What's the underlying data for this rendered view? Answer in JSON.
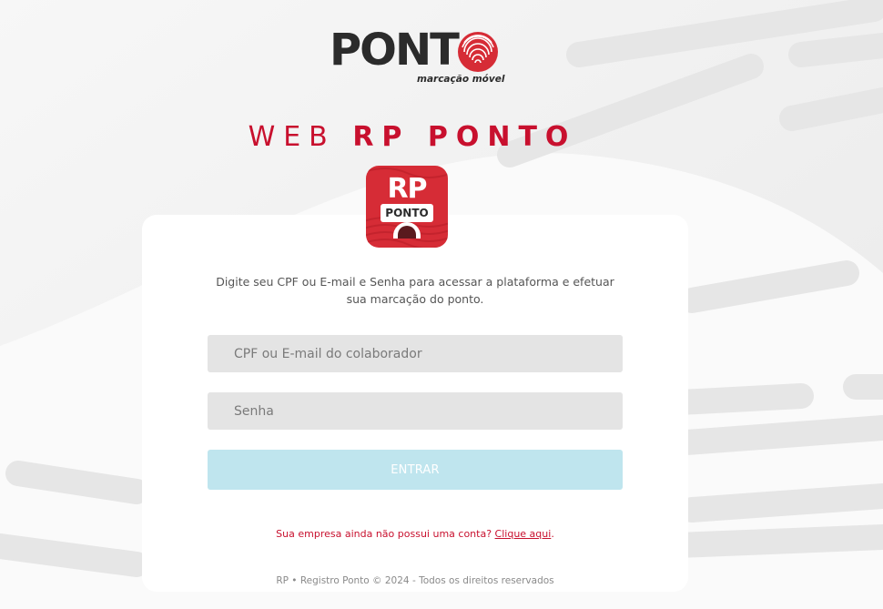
{
  "brand": {
    "wordmark": "PONTO",
    "wordmark_main": "PONT",
    "tagline": "marcação móvel",
    "logo_icon": "fingerprint-icon",
    "accent_color": "#c8102e"
  },
  "hero": {
    "title_light": "WEB",
    "title_bold": "RP PONTO"
  },
  "app_icon": {
    "line1": "RP",
    "line2": "PONTO",
    "background": "#d62c36"
  },
  "login": {
    "intro": "Digite seu CPF ou E-mail e Senha para acessar a plataforma e efetuar sua marcação do ponto.",
    "user_placeholder": "CPF ou E-mail do colaborador",
    "user_value": "",
    "password_placeholder": "Senha",
    "password_value": "",
    "submit_label": "ENTRAR",
    "submit_color": "#bfe5ee"
  },
  "signup": {
    "prompt": "Sua empresa ainda não possui uma conta?",
    "link_label": "Clique aqui",
    "suffix": "."
  },
  "footer": {
    "text": "RP • Registro Ponto © 2024 - Todos os direitos reservados"
  }
}
